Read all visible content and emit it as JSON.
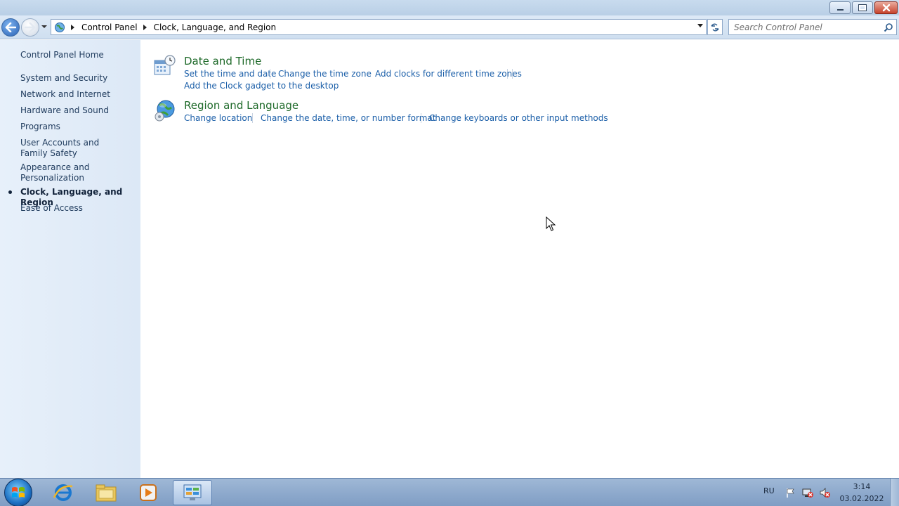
{
  "window": {
    "controls": {
      "minimize_icon": "minimize-icon",
      "restore_icon": "restore-icon",
      "close_icon": "close-icon"
    }
  },
  "address_bar": {
    "breadcrumbs": [
      "Control Panel",
      "Clock, Language, and Region"
    ],
    "search_placeholder": "Search Control Panel"
  },
  "sidebar": {
    "home": "Control Panel Home",
    "items": [
      {
        "label": "System and Security"
      },
      {
        "label": "Network and Internet"
      },
      {
        "label": "Hardware and Sound"
      },
      {
        "label": "Programs"
      },
      {
        "label": "User Accounts and Family Safety"
      },
      {
        "label": "Appearance and Personalization"
      },
      {
        "label": "Clock, Language, and Region",
        "active": true
      },
      {
        "label": "Ease of Access"
      }
    ]
  },
  "categories": [
    {
      "title": "Date and Time",
      "icon": "calendar-clock-icon",
      "tasks": [
        "Set the time and date",
        "Change the time zone",
        "Add clocks for different time zones",
        "Add the Clock gadget to the desktop"
      ]
    },
    {
      "title": "Region and Language",
      "icon": "globe-icon",
      "tasks": [
        "Change location",
        "Change the date, time, or number format",
        "Change keyboards or other input methods"
      ]
    }
  ],
  "taskbar": {
    "apps": [
      "internet-explorer-icon",
      "windows-explorer-icon",
      "media-player-icon",
      "control-panel-icon"
    ],
    "tray": {
      "language": "RU",
      "time": "3:14",
      "date": "03.02.2022"
    }
  },
  "colors": {
    "accent": "#1a5ea8",
    "category_title": "#1f6a2a",
    "sidebar_bg": "#e7f0fa"
  }
}
